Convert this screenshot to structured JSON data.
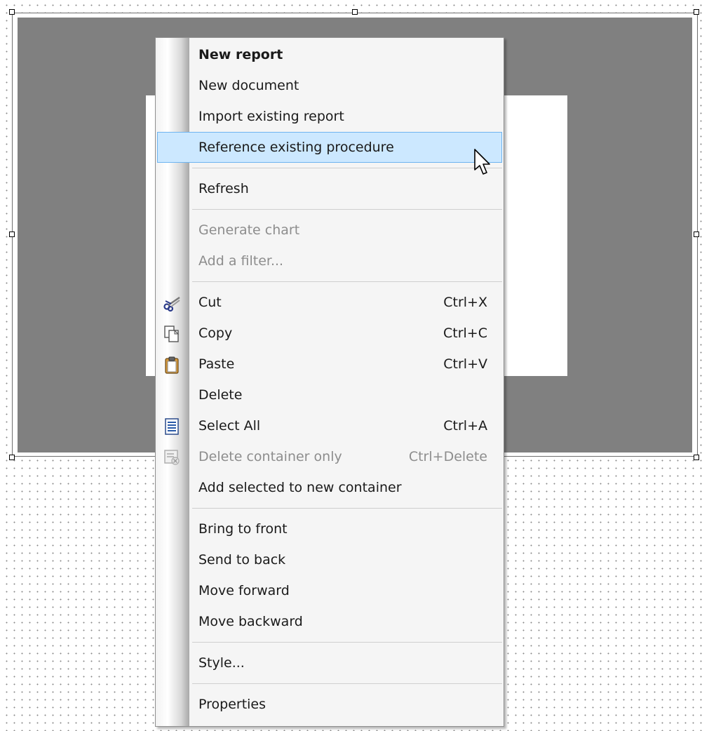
{
  "menu": {
    "items": [
      {
        "label": "New report"
      },
      {
        "label": "New document"
      },
      {
        "label": "Import existing report"
      },
      {
        "label": "Reference existing procedure"
      },
      {
        "label": "Refresh"
      },
      {
        "label": "Generate chart"
      },
      {
        "label": "Add a filter..."
      },
      {
        "label": "Cut",
        "shortcut": "Ctrl+X",
        "icon": "scissors-icon"
      },
      {
        "label": "Copy",
        "shortcut": "Ctrl+C",
        "icon": "copy-icon"
      },
      {
        "label": "Paste",
        "shortcut": "Ctrl+V",
        "icon": "clipboard-icon"
      },
      {
        "label": "Delete"
      },
      {
        "label": "Select All",
        "shortcut": "Ctrl+A",
        "icon": "document-icon"
      },
      {
        "label": "Delete container only",
        "shortcut": "Ctrl+Delete",
        "icon": "container-icon"
      },
      {
        "label": "Add selected to new container"
      },
      {
        "label": "Bring to front"
      },
      {
        "label": "Send to back"
      },
      {
        "label": "Move forward"
      },
      {
        "label": "Move backward"
      },
      {
        "label": "Style..."
      },
      {
        "label": "Properties"
      }
    ],
    "highlighted_item": "Reference existing procedure",
    "disabled_items": [
      "Generate chart",
      "Add a filter...",
      "Delete container only"
    ]
  },
  "colors": {
    "highlight_bg": "#cce8ff",
    "highlight_border": "#6eb4f0",
    "panel_gray": "#808080",
    "disabled_text": "#8d8d8d"
  }
}
